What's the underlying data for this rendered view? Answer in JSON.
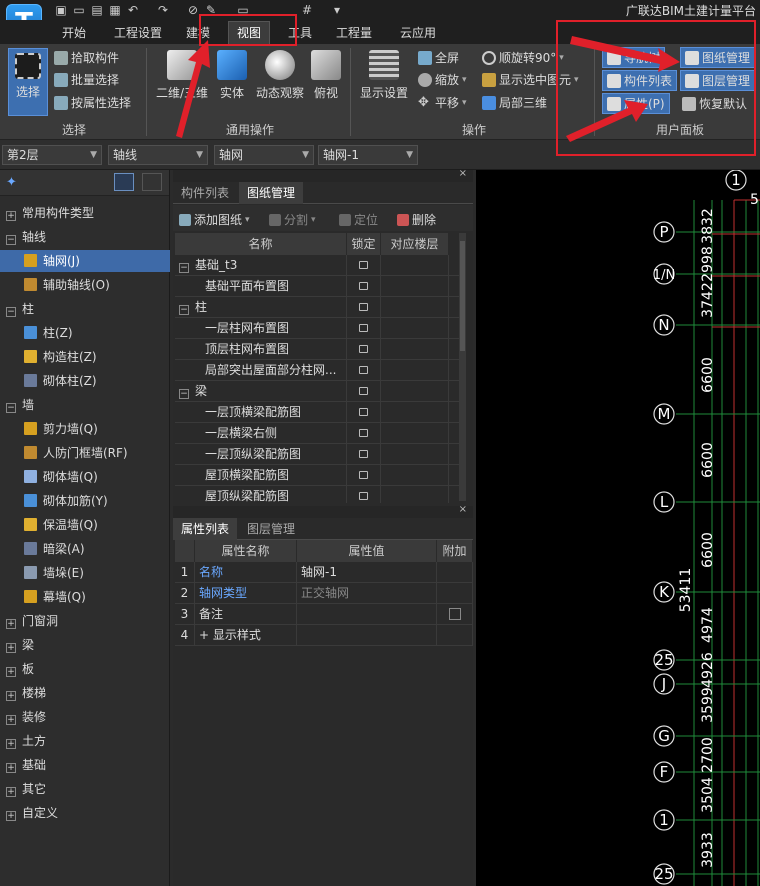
{
  "app": {
    "title": "广联达BIM土建计量平台"
  },
  "menu": {
    "tabs": [
      "开始",
      "工程设置",
      "建模",
      "视图",
      "工具",
      "工程量",
      "云应用"
    ],
    "active": "视图"
  },
  "ribbon": {
    "select": {
      "big": "选择",
      "pick": "拾取构件",
      "batch": "批量选择",
      "byattr": "按属性选择",
      "group": "选择"
    },
    "common": {
      "view2d3d": "二维/三维",
      "solid": "实体",
      "orbit": "动态观察",
      "top": "俯视",
      "group": "通用操作"
    },
    "ops": {
      "display": "显示设置",
      "fullscreen": "全屏",
      "zoom": "缩放",
      "pan": "平移",
      "rotate": "顺旋转90°",
      "showsel": "显示选中图元",
      "local3d": "局部三维",
      "group": "操作"
    },
    "userpanel": {
      "nav": "导航树",
      "drawing_mgmt": "图纸管理",
      "comp_list": "构件列表",
      "layer_mgmt": "图层管理",
      "props": "属性(P)",
      "reset": "恢复默认",
      "group": "用户面板"
    }
  },
  "toolbar": {
    "floor": "第2层",
    "category": "轴线",
    "type": "轴网",
    "instance": "轴网-1"
  },
  "tree": {
    "items": [
      {
        "label": "常用构件类型",
        "kind": "group"
      },
      {
        "label": "轴线",
        "kind": "group-open"
      },
      {
        "label": "轴网(J)",
        "kind": "child",
        "selected": true
      },
      {
        "label": "辅助轴线(O)",
        "kind": "child"
      },
      {
        "label": "柱",
        "kind": "group-open"
      },
      {
        "label": "柱(Z)",
        "kind": "child"
      },
      {
        "label": "构造柱(Z)",
        "kind": "child"
      },
      {
        "label": "砌体柱(Z)",
        "kind": "child"
      },
      {
        "label": "墙",
        "kind": "group-open"
      },
      {
        "label": "剪力墙(Q)",
        "kind": "child"
      },
      {
        "label": "人防门框墙(RF)",
        "kind": "child"
      },
      {
        "label": "砌体墙(Q)",
        "kind": "child"
      },
      {
        "label": "砌体加筋(Y)",
        "kind": "child"
      },
      {
        "label": "保温墙(Q)",
        "kind": "child"
      },
      {
        "label": "暗梁(A)",
        "kind": "child"
      },
      {
        "label": "墙垛(E)",
        "kind": "child"
      },
      {
        "label": "幕墙(Q)",
        "kind": "child"
      },
      {
        "label": "门窗洞",
        "kind": "group"
      },
      {
        "label": "梁",
        "kind": "group"
      },
      {
        "label": "板",
        "kind": "group"
      },
      {
        "label": "楼梯",
        "kind": "group"
      },
      {
        "label": "装修",
        "kind": "group"
      },
      {
        "label": "土方",
        "kind": "group"
      },
      {
        "label": "基础",
        "kind": "group"
      },
      {
        "label": "其它",
        "kind": "group"
      },
      {
        "label": "自定义",
        "kind": "group"
      }
    ]
  },
  "drawing_panel": {
    "tabs": [
      "构件列表",
      "图纸管理"
    ],
    "actions": {
      "add": "添加图纸",
      "split": "分割",
      "locate": "定位",
      "delete": "删除"
    },
    "columns": [
      "名称",
      "锁定",
      "对应楼层"
    ],
    "rows": [
      {
        "name": "基础_t3",
        "group": true
      },
      {
        "name": "基础平面布置图",
        "group": false
      },
      {
        "name": "柱",
        "group": true
      },
      {
        "name": "一层柱网布置图",
        "group": false
      },
      {
        "name": "顶层柱网布置图",
        "group": false
      },
      {
        "name": "局部突出屋面部分柱网...",
        "group": false
      },
      {
        "name": "梁",
        "group": true
      },
      {
        "name": "一层顶横梁配筋图",
        "group": false
      },
      {
        "name": "一层横梁右侧",
        "group": false
      },
      {
        "name": "一层顶纵梁配筋图",
        "group": false
      },
      {
        "name": "屋顶横梁配筋图",
        "group": false
      },
      {
        "name": "屋顶纵梁配筋图",
        "group": false
      }
    ]
  },
  "props_panel": {
    "tabs": [
      "属性列表",
      "图层管理"
    ],
    "columns": [
      "属性名称",
      "属性值",
      "附加"
    ],
    "rows": [
      {
        "n": "1",
        "name": "名称",
        "value": "轴网-1",
        "blue": true
      },
      {
        "n": "2",
        "name": "轴网类型",
        "value": "正交轴网",
        "blue": true
      },
      {
        "n": "3",
        "name": "备注",
        "value": "",
        "blue": false
      },
      {
        "n": "4",
        "name": "+ 显示样式",
        "value": "",
        "blue": false
      }
    ]
  },
  "canvas": {
    "axes": [
      "1",
      "P",
      "1/N",
      "N",
      "M",
      "L",
      "K",
      "25",
      "J",
      "G",
      "F",
      "1",
      "25"
    ],
    "dims": [
      "3832",
      "2998",
      "3742",
      "6600",
      "6600",
      "6600",
      "4974",
      "4926",
      "3599",
      "2700",
      "3504",
      "3933"
    ],
    "total": "53411",
    "top_label": "5"
  }
}
